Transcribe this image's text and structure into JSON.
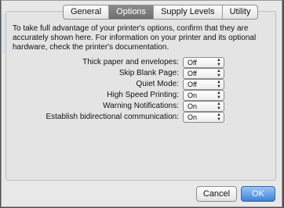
{
  "tabs": [
    {
      "label": "General"
    },
    {
      "label": "Options"
    },
    {
      "label": "Supply Levels"
    },
    {
      "label": "Utility"
    }
  ],
  "description": "To take full advantage of your printer's options, confirm that they are accurately shown here. For information on your printer and its optional hardware, check the printer's documentation.",
  "options": [
    {
      "label": "Thick paper and envelopes:",
      "value": "Off"
    },
    {
      "label": "Skip Blank Page:",
      "value": "Off"
    },
    {
      "label": "Quiet Mode:",
      "value": "Off"
    },
    {
      "label": "High Speed Printing:",
      "value": "On"
    },
    {
      "label": "Warning Notifications:",
      "value": "On"
    },
    {
      "label": "Establish bidirectional communication:",
      "value": "On"
    }
  ],
  "buttons": {
    "cancel": "Cancel",
    "ok": "OK"
  },
  "selected_tab": "Options",
  "colors": {
    "accent": "#3b82dc",
    "active_tab": "#7a7a7a"
  }
}
